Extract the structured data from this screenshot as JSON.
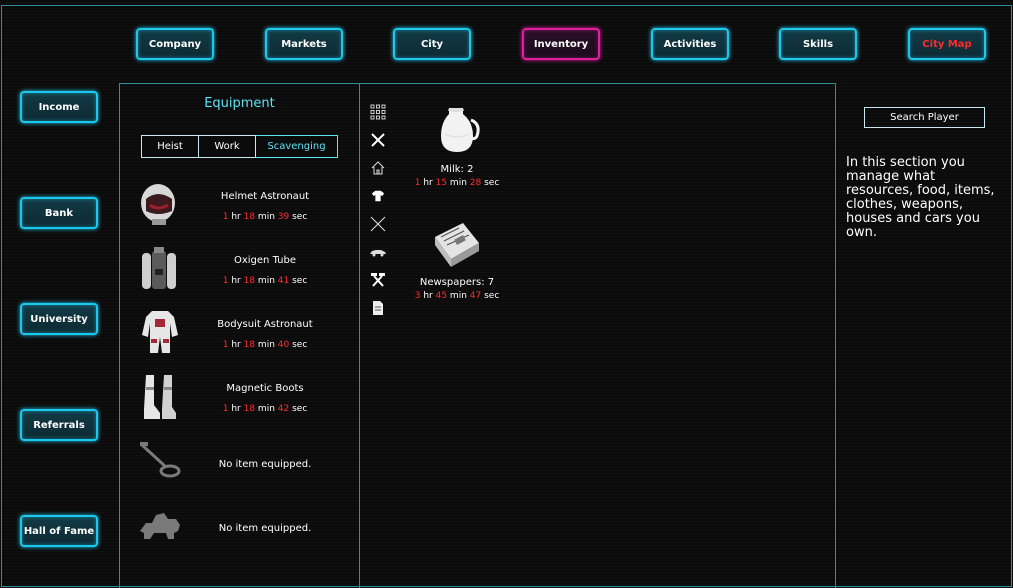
{
  "top_nav": [
    {
      "label": "Company"
    },
    {
      "label": "Markets"
    },
    {
      "label": "City"
    },
    {
      "label": "Inventory"
    },
    {
      "label": "Activities"
    },
    {
      "label": "Skills"
    },
    {
      "label": "City Map"
    }
  ],
  "side_nav": [
    {
      "label": "Income"
    },
    {
      "label": "Bank"
    },
    {
      "label": "University"
    },
    {
      "label": "Referrals"
    },
    {
      "label": "Hall of Fame"
    }
  ],
  "equipment": {
    "title": "Equipment",
    "tabs": [
      {
        "label": "Heist"
      },
      {
        "label": "Work"
      },
      {
        "label": "Scavenging"
      }
    ],
    "active_tab": "Scavenging",
    "units": {
      "hr": "hr",
      "min": "min",
      "sec": "sec"
    },
    "items": [
      {
        "name": "Helmet Astronaut",
        "icon": "helmet-icon",
        "hr": "1",
        "min": "18",
        "sec": "39"
      },
      {
        "name": "Oxigen Tube",
        "icon": "oxygen-tank-icon",
        "hr": "1",
        "min": "18",
        "sec": "41"
      },
      {
        "name": "Bodysuit Astronaut",
        "icon": "bodysuit-icon",
        "hr": "1",
        "min": "18",
        "sec": "40"
      },
      {
        "name": "Magnetic Boots",
        "icon": "boots-icon",
        "hr": "1",
        "min": "18",
        "sec": "42"
      },
      {
        "empty_text": "No item equipped.",
        "icon": "metal-detector-icon"
      },
      {
        "empty_text": "No item equipped.",
        "icon": "vehicle-silhouette-icon"
      }
    ]
  },
  "inventory": {
    "categories": [
      "grid-icon",
      "food-icon",
      "house-icon",
      "shirt-icon",
      "weapons-icon",
      "car-icon",
      "tools-icon",
      "document-icon"
    ],
    "items": [
      {
        "name": "Milk: 2",
        "icon": "milk-jug-icon",
        "hr": "1",
        "min": "15",
        "sec": "28"
      },
      {
        "name": "Newspapers: 7",
        "icon": "newspapers-icon",
        "hr": "3",
        "min": "45",
        "sec": "47"
      }
    ]
  },
  "search_button": "Search Player",
  "info_text": "In this section you manage what resources, food, items, clothes, weapons, houses and cars you own.",
  "colors": {
    "accent": "#1cc8ec",
    "active": "#e21f9e",
    "highlight": "#ff2a2a",
    "title": "#5fe3f5"
  }
}
